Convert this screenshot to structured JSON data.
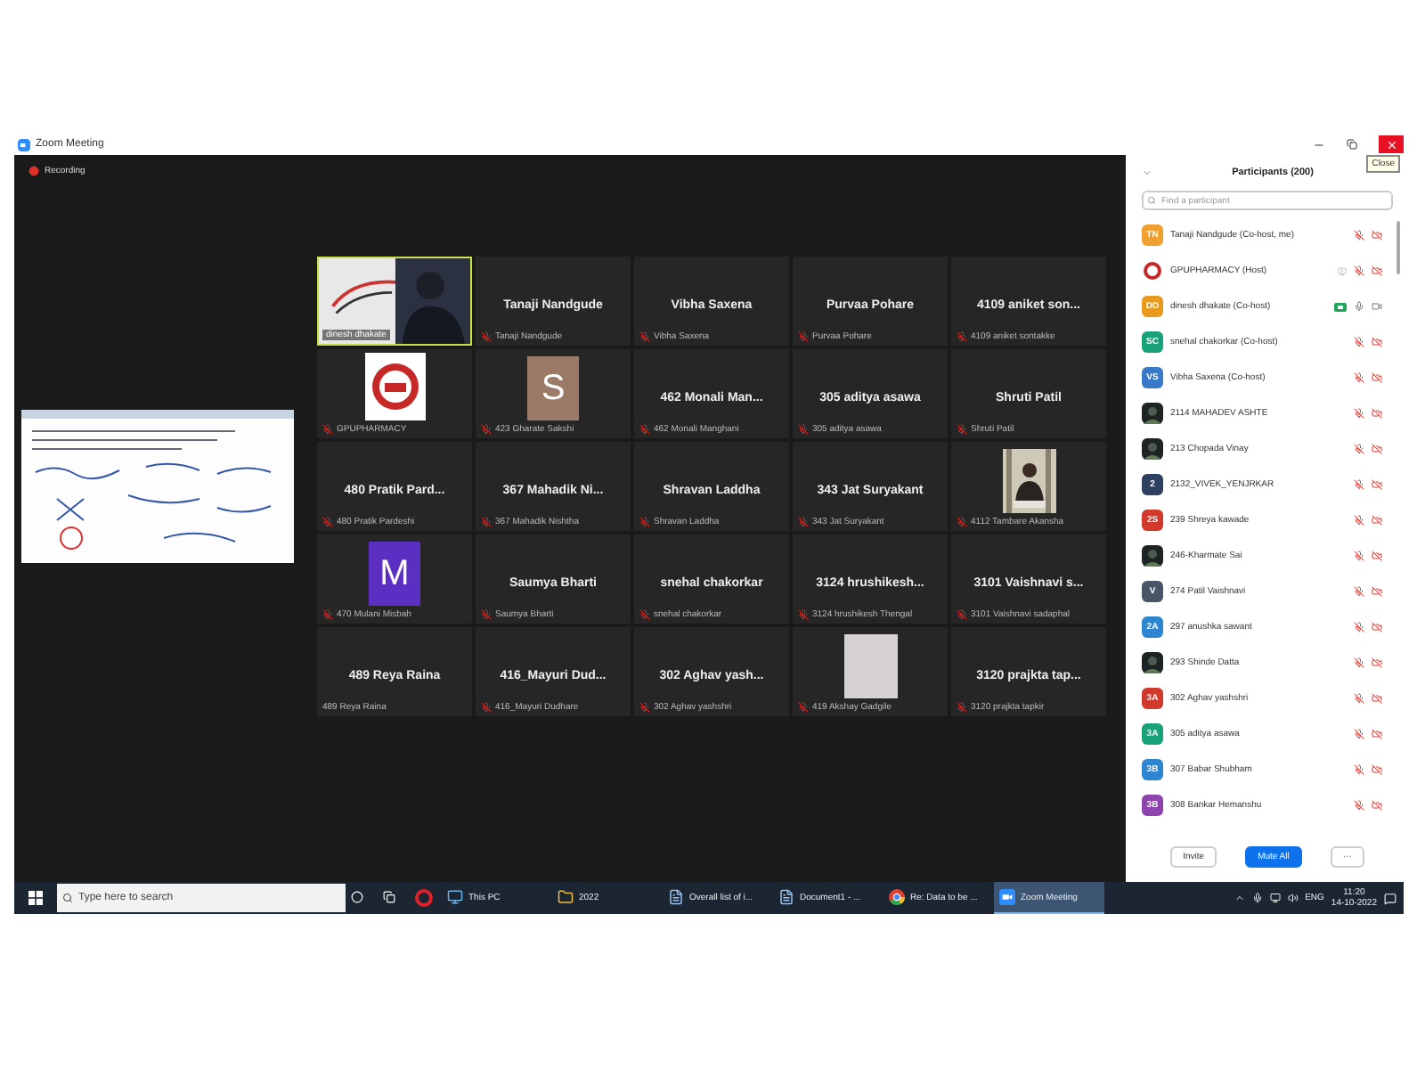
{
  "window": {
    "title": "Zoom Meeting",
    "recording": "Recording",
    "close_tooltip": "Close"
  },
  "tiles": [
    {
      "kind": "video",
      "label": "dinesh dhakate",
      "muted": false,
      "active": true
    },
    {
      "kind": "name",
      "name": "Tanaji Nandgude",
      "label": "Tanaji Nandgude",
      "muted": true,
      "active": false
    },
    {
      "kind": "name",
      "name": "Vibha Saxena",
      "label": "Vibha Saxena",
      "muted": true,
      "active": false
    },
    {
      "kind": "name",
      "name": "Purvaa Pohare",
      "label": "Purvaa Pohare",
      "muted": true,
      "active": false
    },
    {
      "kind": "name",
      "name": "4109 aniket son...",
      "label": "4109 aniket sontakke",
      "muted": true,
      "active": false
    },
    {
      "kind": "logo",
      "label": "GPUPHARMACY",
      "muted": true,
      "active": false
    },
    {
      "kind": "avatar",
      "initial": "S",
      "color": "#9b7a68",
      "label": "423 Gharate Sakshi",
      "muted": true,
      "active": false
    },
    {
      "kind": "name",
      "name": "462 Monali Man...",
      "label": "462 Monali Manghani",
      "muted": true,
      "active": false
    },
    {
      "kind": "name",
      "name": "305 aditya asawa",
      "label": "305 aditya asawa",
      "muted": true,
      "active": false
    },
    {
      "kind": "name",
      "name": "Shruti Patil",
      "label": "Shruti Patil",
      "muted": true,
      "active": false
    },
    {
      "kind": "name",
      "name": "480 Pratik Pard...",
      "label": "480 Pratik Pardeshi",
      "muted": true,
      "active": false
    },
    {
      "kind": "name",
      "name": "367 Mahadik Ni...",
      "label": "367 Mahadik Nishtha",
      "muted": true,
      "active": false
    },
    {
      "kind": "name",
      "name": "Shravan Laddha",
      "label": "Shravan Laddha",
      "muted": true,
      "active": false
    },
    {
      "kind": "name",
      "name": "343 Jat Suryakant",
      "label": "343 Jat Suryakant",
      "muted": true,
      "active": false
    },
    {
      "label": "4112 Tambare Akansha",
      "muted": true,
      "active": false
    },
    {
      "kind": "avatar",
      "initial": "M",
      "color": "#5b2fc2",
      "label": "470  Mulani Misbah",
      "muted": true,
      "active": false
    },
    {
      "kind": "name",
      "name": "Saumya Bharti",
      "label": "Saumya Bharti",
      "muted": true,
      "active": false
    },
    {
      "kind": "name",
      "name": "snehal chakorkar",
      "label": "snehal chakorkar",
      "muted": true,
      "active": false
    },
    {
      "kind": "name",
      "name": "3124 hrushikesh...",
      "label": "3124 hrushikesh Thengal",
      "muted": true,
      "active": false
    },
    {
      "kind": "name",
      "name": "3101 Vaishnavi s...",
      "label": "3101 Vaishnavi sadaphal",
      "muted": true,
      "active": false
    },
    {
      "kind": "name",
      "name": "489 Reya Raina",
      "label": "489 Reya Raina",
      "muted": false,
      "active": false
    },
    {
      "kind": "name",
      "name": "416_Mayuri  Dud...",
      "label": "416_Mayuri Dudhare",
      "muted": true,
      "active": false
    },
    {
      "kind": "name",
      "name": "302 Aghav yash...",
      "label": "302 Aghav yashshri",
      "muted": true,
      "active": false
    },
    {
      "kind": "blank",
      "label": "419 Akshay Gadgile",
      "muted": true,
      "active": false
    },
    {
      "kind": "name",
      "name": "3120 prajkta tap...",
      "label": "3120 prajkta tapkir",
      "muted": true,
      "active": false
    }
  ],
  "participants": {
    "title": "Participants (200)",
    "search": {
      "placeholder": "Find a participant"
    },
    "items": [
      {
        "kind": "initials",
        "initials": "TN",
        "color": "#f0a030",
        "name": "Tanaji Nandgude (Co-host, me)",
        "muted": true,
        "video_on": false,
        "sharing": false
      },
      {
        "kind": "logo",
        "name": "GPUPHARMACY (Host)",
        "muted": true,
        "video_on": false,
        "sharing": true
      },
      {
        "kind": "initials",
        "initials": "DD",
        "color": "#e89a1c",
        "name": "dinesh dhakate (Co-host)",
        "muted": false,
        "video_on": true,
        "sharing": false
      },
      {
        "kind": "initials",
        "initials": "SC",
        "color": "#1aa37a",
        "name": "snehal chakorkar (Co-host)",
        "muted": true,
        "video_on": false,
        "sharing": false
      },
      {
        "kind": "initials",
        "initials": "VS",
        "color": "#3a78c8",
        "name": "Vibha Saxena (Co-host)",
        "muted": true,
        "video_on": false,
        "sharing": false
      },
      {
        "name": "2114 MAHADEV ASHTE",
        "muted": true,
        "video_on": false,
        "sharing": false
      },
      {
        "name": "213 Chopada Vinay",
        "muted": true,
        "video_on": false,
        "sharing": false
      },
      {
        "kind": "initials",
        "initials": "2",
        "color": "#2d4060",
        "name": "2132_VIVEK_YENJRKAR",
        "muted": true,
        "video_on": false,
        "sharing": false
      },
      {
        "kind": "initials",
        "initials": "2S",
        "color": "#d0392b",
        "name": "239 Shreya kawade",
        "muted": true,
        "video_on": false,
        "sharing": false
      },
      {
        "name": "246-Kharmate Sai",
        "muted": true,
        "video_on": false,
        "sharing": false
      },
      {
        "kind": "initials",
        "initials": "V",
        "color": "#4a5568",
        "name": "274 Patil Vaishnavi",
        "muted": true,
        "video_on": false,
        "sharing": false
      },
      {
        "kind": "initials",
        "initials": "2A",
        "color": "#2f86d0",
        "name": "297 anushka sawant",
        "muted": true,
        "video_on": false,
        "sharing": false
      },
      {
        "name": "293 Shinde Datta",
        "muted": true,
        "video_on": false,
        "sharing": false
      },
      {
        "kind": "initials",
        "initials": "3A",
        "color": "#d0392b",
        "name": "302 Aghav yashshri",
        "muted": true,
        "video_on": false,
        "sharing": false
      },
      {
        "kind": "initials",
        "initials": "3A",
        "color": "#1aa37a",
        "name": "305 aditya asawa",
        "muted": true,
        "video_on": false,
        "sharing": false
      },
      {
        "kind": "initials",
        "initials": "3B",
        "color": "#2f86d0",
        "name": "307 Babar Shubham",
        "muted": true,
        "video_on": false,
        "sharing": false
      },
      {
        "kind": "initials",
        "initials": "3B",
        "color": "#8e44ad",
        "name": "308 Bankar Hemanshu",
        "muted": true,
        "video_on": false,
        "sharing": false
      }
    ],
    "buttons": [
      {
        "label": "Invite",
        "primary": false
      },
      {
        "label": "Mute All",
        "primary": true
      }
    ],
    "more": "···"
  },
  "taskbar": {
    "search": {
      "placeholder": "Type here to search"
    },
    "apps": [
      {
        "kind": "opera",
        "selected": false
      },
      {
        "kind": "explorer",
        "label": "This PC",
        "selected": false
      },
      {
        "kind": "folder",
        "label": "2022",
        "selected": false
      },
      {
        "kind": "doc",
        "label": "Overall list of i...",
        "selected": false
      },
      {
        "kind": "doc",
        "label": "Document1 - ...",
        "selected": false
      },
      {
        "kind": "chrome",
        "label": "Re: Data to be ...",
        "selected": false
      },
      {
        "kind": "zoom",
        "label": "Zoom Meeting",
        "selected": true
      }
    ],
    "language": "ENG",
    "time": "11:20",
    "date": "14-10-2022"
  }
}
